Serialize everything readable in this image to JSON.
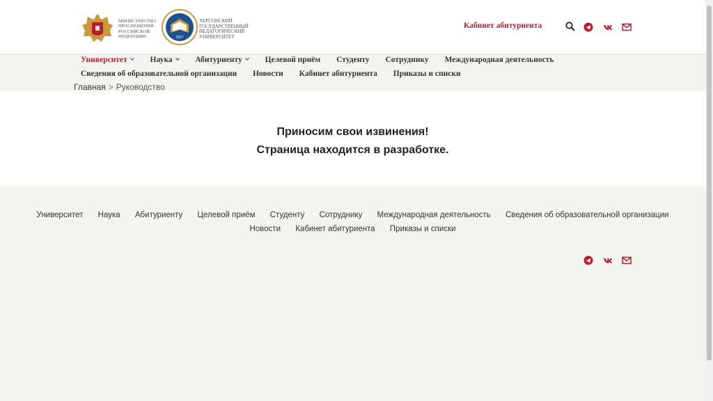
{
  "header": {
    "ministry_lines": [
      "МИНИСТЕРСТВО",
      "ПРОСВЕЩЕНИЯ",
      "РОССИЙСКОЙ",
      "ФЕДЕРАЦИИ"
    ],
    "university_lines": [
      "ХЕРСОНСКИЙ",
      "ГОСУДАРСТВЕННЫЙ",
      "ПЕДАГОГИЧЕСКИЙ",
      "УНИВЕРСИТЕТ"
    ],
    "university_year": "1917",
    "cabinet_link": "Кабинет абитуриента"
  },
  "nav": {
    "row1": [
      {
        "label": "Университет",
        "active": true,
        "has_dropdown": true
      },
      {
        "label": "Наука",
        "active": false,
        "has_dropdown": true
      },
      {
        "label": "Абитуриенту",
        "active": false,
        "has_dropdown": true
      },
      {
        "label": "Целевой приём",
        "active": false,
        "has_dropdown": false
      },
      {
        "label": "Студенту",
        "active": false,
        "has_dropdown": false
      },
      {
        "label": "Сотруднику",
        "active": false,
        "has_dropdown": false
      },
      {
        "label": "Международная деятельность",
        "active": false,
        "has_dropdown": false
      }
    ],
    "row2": [
      {
        "label": "Сведения об образовательной организации"
      },
      {
        "label": "Новости"
      },
      {
        "label": "Кабинет абитуриента"
      },
      {
        "label": "Приказы и списки"
      }
    ]
  },
  "breadcrumb": {
    "home": "Главная",
    "separator": ">",
    "current": "Руководство"
  },
  "content": {
    "line1": "Приносим свои извинения!",
    "line2": "Страница находится в разработке."
  },
  "footer": {
    "row1": [
      "Университет",
      "Наука",
      "Абитуриенту",
      "Целевой приём",
      "Студенту",
      "Сотруднику",
      "Международная деятельность",
      "Сведения об образовательной организации"
    ],
    "row2": [
      "Новости",
      "Кабинет абитуриента",
      "Приказы и списки"
    ]
  },
  "icons": [
    "search-icon",
    "telegram-icon",
    "vk-icon",
    "mail-icon"
  ],
  "colors": {
    "accent": "#b31f2a",
    "footer_bg": "#f3f4f1",
    "header_bg": "#ffffff",
    "text": "#333333"
  }
}
